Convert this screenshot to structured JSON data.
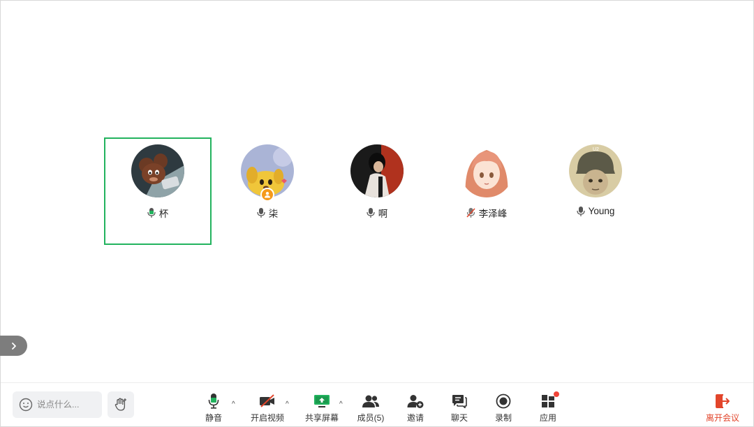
{
  "participants": [
    {
      "name": "杯",
      "mic": "speaking",
      "active": true
    },
    {
      "name": "柒",
      "mic": "on",
      "host": true
    },
    {
      "name": "啊",
      "mic": "on"
    },
    {
      "name": "李泽峰",
      "mic": "muted"
    },
    {
      "name": "Young",
      "mic": "on"
    }
  ],
  "chat": {
    "placeholder": "说点什么..."
  },
  "toolbar": {
    "mute": "静音",
    "video": "开启视频",
    "share": "共享屏幕",
    "members": "成员(5)",
    "invite": "邀请",
    "chat": "聊天",
    "record": "录制",
    "apps": "应用",
    "leave": "离开会议"
  },
  "colors": {
    "accent_green": "#22b35e",
    "leave_red": "#e2452b",
    "host_badge": "#f59a1b",
    "notification_dot": "#f04438"
  }
}
